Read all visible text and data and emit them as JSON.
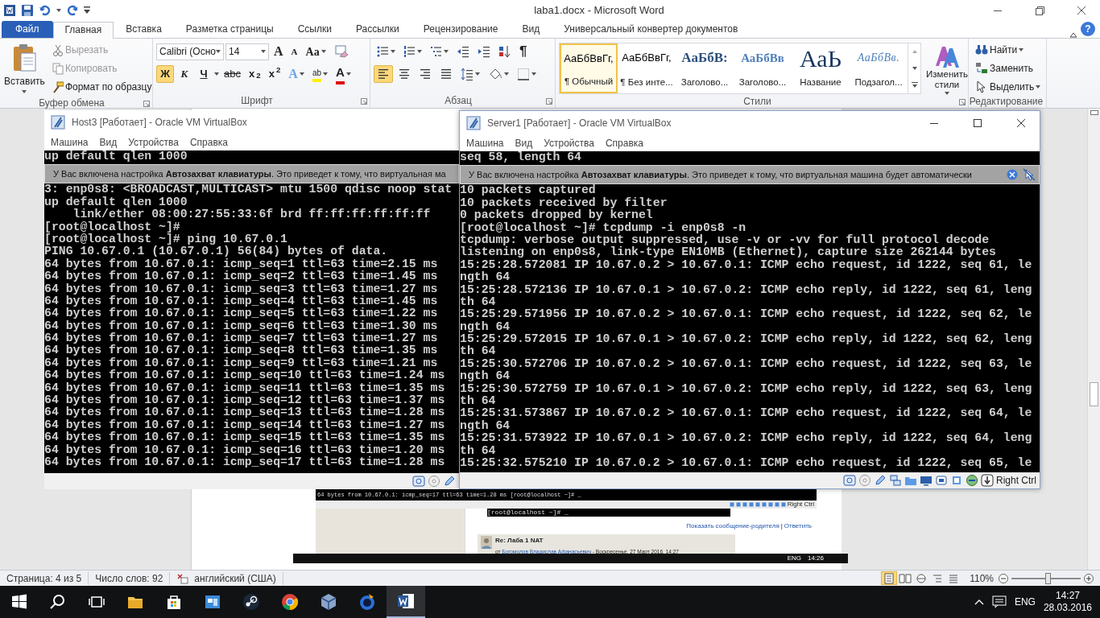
{
  "word": {
    "title": "laba1.docx - Microsoft Word",
    "help": "?"
  },
  "ribbon_tabs": [
    {
      "label": "Файл",
      "kind": "file",
      "selected": false
    },
    {
      "label": "Главная",
      "kind": "tab",
      "selected": true
    },
    {
      "label": "Вставка",
      "kind": "tab",
      "selected": false
    },
    {
      "label": "Разметка страницы",
      "kind": "tab",
      "selected": false
    },
    {
      "label": "Ссылки",
      "kind": "tab",
      "selected": false
    },
    {
      "label": "Рассылки",
      "kind": "tab",
      "selected": false
    },
    {
      "label": "Рецензирование",
      "kind": "tab",
      "selected": false
    },
    {
      "label": "Вид",
      "kind": "tab",
      "selected": false
    },
    {
      "label": "Универсальный конвертер документов",
      "kind": "tab",
      "selected": false
    }
  ],
  "clipboard": {
    "label": "Буфер обмена",
    "paste": "Вставить",
    "items": [
      {
        "label": "Вырезать",
        "kind": "cut",
        "disabled": true
      },
      {
        "label": "Копировать",
        "kind": "copy",
        "disabled": true
      },
      {
        "label": "Формат по образцу",
        "kind": "painter",
        "disabled": false
      }
    ]
  },
  "font": {
    "label": "Шрифт",
    "family": "Calibri (Осно",
    "size": "14",
    "grow": "A",
    "shrink": "A",
    "change_case": "Aa",
    "formats": [
      {
        "label": "Ж",
        "kind": "bold",
        "selected": true
      },
      {
        "label": "К",
        "kind": "italic",
        "selected": false
      },
      {
        "label": "Ч",
        "kind": "underline",
        "selected": false
      },
      {
        "label": "abc",
        "kind": "strike",
        "selected": false
      },
      {
        "label": "x$_{2}$",
        "kind": "sub",
        "selected": false
      },
      {
        "label": "x$^{2}$",
        "kind": "sup",
        "selected": false
      }
    ],
    "effects": [
      {
        "label": "A",
        "kind": "effects"
      },
      {
        "label": "ab",
        "kind": "highlight"
      },
      {
        "label": "A",
        "kind": "color"
      }
    ]
  },
  "paragraph": {
    "label": "Абзац",
    "marks": "¶",
    "alignments": [
      {
        "kind": "left",
        "selected": true
      },
      {
        "kind": "center",
        "selected": false
      },
      {
        "kind": "right",
        "selected": false
      },
      {
        "kind": "justify",
        "selected": false
      }
    ]
  },
  "styles": {
    "label": "Стили",
    "change": "Изменить стили",
    "items": [
      {
        "sample": "АаБбВвГг,",
        "name": "¶ Обычный",
        "kind": "normal",
        "selected": true
      },
      {
        "sample": "АаБбВвГг,",
        "name": "¶ Без инте...",
        "kind": "normal",
        "selected": false
      },
      {
        "sample": "АаБбВ:",
        "name": "Заголово...",
        "kind": "heading1",
        "selected": false
      },
      {
        "sample": "АаБбВв",
        "name": "Заголово...",
        "kind": "heading2",
        "selected": false
      },
      {
        "sample": "АаЬ",
        "name": "Название",
        "kind": "title",
        "selected": false
      },
      {
        "sample": "АаБбВв.",
        "name": "Подзагол...",
        "kind": "subtitle",
        "selected": false
      }
    ]
  },
  "editing": {
    "label": "Редактирование",
    "items": [
      {
        "label": "Найти",
        "kind": "find"
      },
      {
        "label": "Заменить",
        "kind": "replace"
      },
      {
        "label": "Выделить",
        "kind": "select"
      }
    ]
  },
  "vms": [
    {
      "title": "Host3 [Работает] - Oracle VM VirtualBox",
      "active": false,
      "menu": [
        "Машина",
        "Вид",
        "Устройства",
        "Справка"
      ],
      "lines_top": [
        "up default qlen 1000"
      ],
      "notice": "У Вас включена настройка **Автозахват клавиатуры**. Это приведет к тому, что виртуальная ма",
      "lines": [
        "3: enp0s8: <BROADCAST,MULTICAST> mtu 1500 qdisc noop stat",
        "up default qlen 1000",
        "    link/ether 08:00:27:55:33:6f brd ff:ff:ff:ff:ff:ff",
        "[root@localhost ~]#",
        "[root@localhost ~]# ping 10.67.0.1",
        "PING 10.67.0.1 (10.67.0.1) 56(84) bytes of data.",
        "64 bytes from 10.67.0.1: icmp_seq=1 ttl=63 time=2.15 ms",
        "64 bytes from 10.67.0.1: icmp_seq=2 ttl=63 time=1.45 ms",
        "64 bytes from 10.67.0.1: icmp_seq=3 ttl=63 time=1.27 ms",
        "64 bytes from 10.67.0.1: icmp_seq=4 ttl=63 time=1.45 ms",
        "64 bytes from 10.67.0.1: icmp_seq=5 ttl=63 time=1.22 ms",
        "64 bytes from 10.67.0.1: icmp_seq=6 ttl=63 time=1.30 ms",
        "64 bytes from 10.67.0.1: icmp_seq=7 ttl=63 time=1.27 ms",
        "64 bytes from 10.67.0.1: icmp_seq=8 ttl=63 time=1.35 ms",
        "64 bytes from 10.67.0.1: icmp_seq=9 ttl=63 time=1.21 ms",
        "64 bytes from 10.67.0.1: icmp_seq=10 ttl=63 time=1.24 ms",
        "64 bytes from 10.67.0.1: icmp_seq=11 ttl=63 time=1.35 ms",
        "64 bytes from 10.67.0.1: icmp_seq=12 ttl=63 time=1.37 ms",
        "64 bytes from 10.67.0.1: icmp_seq=13 ttl=63 time=1.28 ms",
        "64 bytes from 10.67.0.1: icmp_seq=14 ttl=63 time=1.27 ms",
        "64 bytes from 10.67.0.1: icmp_seq=15 ttl=63 time=1.35 ms",
        "64 bytes from 10.67.0.1: icmp_seq=16 ttl=63 time=1.20 ms",
        "64 bytes from 10.67.0.1: icmp_seq=17 ttl=63 time=1.28 ms"
      ]
    },
    {
      "title": "Server1 [Работает] - Oracle VM VirtualBox",
      "active": true,
      "host_key": "Right Ctrl",
      "menu": [
        "Машина",
        "Вид",
        "Устройства",
        "Справка"
      ],
      "lines_top": [
        "seq 58, length 64"
      ],
      "notice": "У Вас включена настройка **Автозахват клавиатуры**. Это приведет к тому, что виртуальная машина будет автоматически",
      "lines": [
        "10 packets captured",
        "10 packets received by filter",
        "0 packets dropped by kernel",
        "[root@localhost ~]# tcpdump -i enp0s8 -n",
        "tcpdump: verbose output suppressed, use -v or -vv for full protocol decode",
        "listening on enp0s8, link-type EN10MB (Ethernet), capture size 262144 bytes",
        "15:25:28.572081 IP 10.67.0.2 > 10.67.0.1: ICMP echo request, id 1222, seq 61, le",
        "ngth 64",
        "15:25:28.572136 IP 10.67.0.1 > 10.67.0.2: ICMP echo reply, id 1222, seq 61, leng",
        "th 64",
        "15:25:29.571956 IP 10.67.0.2 > 10.67.0.1: ICMP echo request, id 1222, seq 62, le",
        "ngth 64",
        "15:25:29.572015 IP 10.67.0.1 > 10.67.0.2: ICMP echo reply, id 1222, seq 62, leng",
        "th 64",
        "15:25:30.572706 IP 10.67.0.2 > 10.67.0.1: ICMP echo request, id 1222, seq 63, le",
        "ngth 64",
        "15:25:30.572759 IP 10.67.0.1 > 10.67.0.2: ICMP echo reply, id 1222, seq 63, leng",
        "th 64",
        "15:25:31.573867 IP 10.67.0.2 > 10.67.0.1: ICMP echo request, id 1222, seq 64, le",
        "ngth 64",
        "15:25:31.573922 IP 10.67.0.1 > 10.67.0.2: ICMP echo reply, id 1222, seq 64, leng",
        "th 64",
        "15:25:32.575210 IP 10.67.0.2 > 10.67.0.1: ICMP echo request, id 1222, seq 65, le"
      ]
    }
  ],
  "document": {
    "embedded": {
      "terminal_line": "64 bytes from 10.67.0.1: icmp_seq=17 ttl=63 time=1.28 ms [root@localhost ~]# _",
      "host_key": "Right Ctrl",
      "prompt": "[root@localhost ~]# _",
      "links": [
        "Показать сообщение-родителя",
        "Ответить"
      ],
      "separator": "|",
      "post_title": "Re: Лаба 1 NAT",
      "post_prefix": "от",
      "post_author": "Богомолов Владислав Афанасьевич",
      "post_date": "- Воскресенье, 27 Март 2016, 14:27",
      "tray_lang": "ENG",
      "tray_time": "14:26"
    }
  },
  "status_bar": {
    "page": "Страница: 4 из 5",
    "words": "Число слов: 92",
    "language": "английский (США)",
    "zoom": "110%",
    "views": [
      {
        "kind": "print",
        "selected": true
      },
      {
        "kind": "reading",
        "selected": false
      },
      {
        "kind": "web",
        "selected": false
      },
      {
        "kind": "outline",
        "selected": false
      },
      {
        "kind": "draft",
        "selected": false
      }
    ],
    "zoom_slider": {
      "level": 0.52
    }
  },
  "taskbar": {
    "apps": [
      {
        "kind": "explorer",
        "active": false
      },
      {
        "kind": "store",
        "active": false
      },
      {
        "kind": "app",
        "active": false
      },
      {
        "kind": "steam",
        "active": false
      },
      {
        "kind": "chrome",
        "active": false
      },
      {
        "kind": "virtualbox",
        "active": false
      },
      {
        "kind": "browser",
        "active": false
      },
      {
        "kind": "word",
        "active": true
      }
    ],
    "language": "ENG",
    "time": "14:27",
    "date": "28.03.2016"
  }
}
